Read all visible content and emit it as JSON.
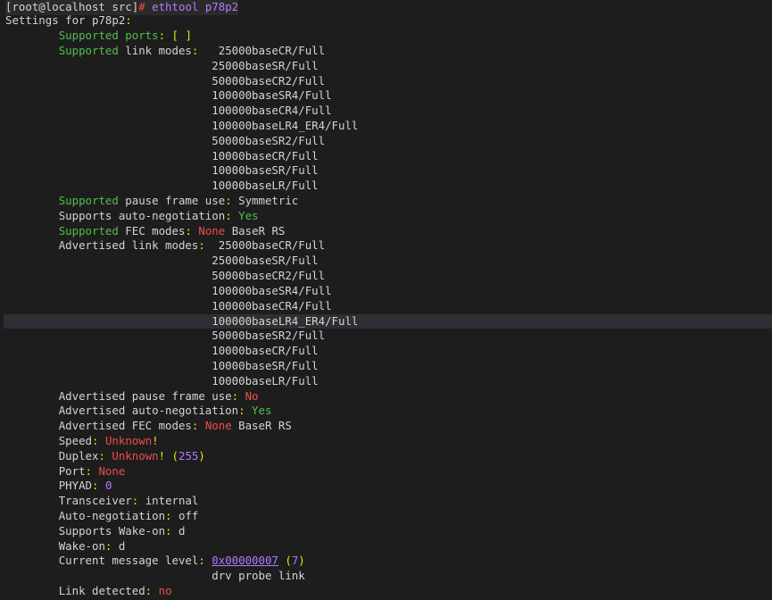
{
  "prompt": {
    "user_host": "[root@localhost src]",
    "symbol": "#",
    "command": "ethtool p78p2"
  },
  "settings_header": "Settings for p78p2",
  "supported_ports": {
    "label_word": "Supported",
    "label_rest": " ports",
    "value": "[ ]"
  },
  "supported_link_modes": {
    "label_word": "Supported",
    "label_rest": " link modes",
    "modes": [
      "25000baseCR/Full",
      "25000baseSR/Full",
      "50000baseCR2/Full",
      "100000baseSR4/Full",
      "100000baseCR4/Full",
      "100000baseLR4_ER4/Full",
      "50000baseSR2/Full",
      "10000baseCR/Full",
      "10000baseSR/Full",
      "10000baseLR/Full"
    ]
  },
  "supported_pause": {
    "label_word": "Supported",
    "label_rest": " pause frame use",
    "value": "Symmetric"
  },
  "supports_autoneg": {
    "label": "Supports auto-negotiation",
    "value": "Yes"
  },
  "supported_fec": {
    "label_word": "Supported",
    "label_rest": " FEC modes",
    "value_none": "None",
    "value_rest": "BaseR RS"
  },
  "advertised_link_modes": {
    "label": "Advertised link modes",
    "modes": [
      "25000baseCR/Full",
      "25000baseSR/Full",
      "50000baseCR2/Full",
      "100000baseSR4/Full",
      "100000baseCR4/Full",
      "100000baseLR4_ER4/Full",
      "50000baseSR2/Full",
      "10000baseCR/Full",
      "10000baseSR/Full",
      "10000baseLR/Full"
    ]
  },
  "advertised_pause": {
    "label": "Advertised pause frame use",
    "value": "No"
  },
  "advertised_autoneg": {
    "label": "Advertised auto-negotiation",
    "value": "Yes"
  },
  "advertised_fec": {
    "label": "Advertised FEC modes",
    "value_none": "None",
    "value_rest": "BaseR RS"
  },
  "speed": {
    "label": "Speed",
    "value": "Unknown",
    "bang": "!"
  },
  "duplex": {
    "label": "Duplex",
    "value": "Unknown",
    "bang": "!",
    "code": "255"
  },
  "port": {
    "label": "Port",
    "value": "None"
  },
  "phyad": {
    "label": "PHYAD",
    "value": "0"
  },
  "transceiver": {
    "label": "Transceiver",
    "value": "internal"
  },
  "autoneg": {
    "label": "Auto-negotiation",
    "value": "off"
  },
  "supports_wake_on": {
    "label": "Supports Wake-on",
    "value": "d"
  },
  "wake_on": {
    "label": "Wake-on",
    "value": "d"
  },
  "msg_level": {
    "label": "Current message level",
    "hex": "0x00000007",
    "dec": "7",
    "flags": "drv probe link"
  },
  "link_detected": {
    "label": "Link detected",
    "value": "no"
  }
}
